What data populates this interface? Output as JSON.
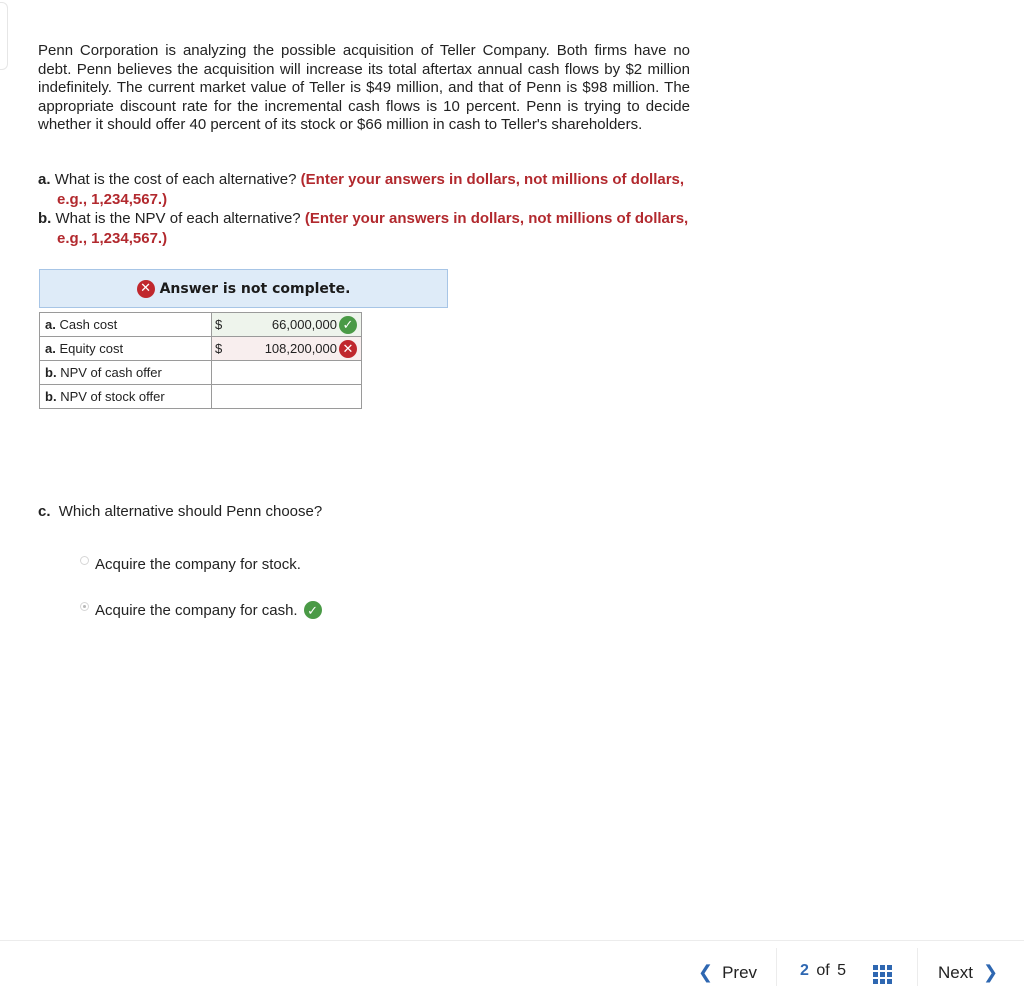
{
  "problem_text": "Penn Corporation is analyzing the possible acquisition of Teller Company. Both firms have no debt. Penn believes the acquisition will increase its total aftertax annual cash flows by $2 million indefinitely. The current market value of Teller is $49 million, and that of Penn is $98 million. The appropriate discount rate for the incremental cash flows is 10 percent. Penn is trying to decide whether it should offer 40 percent of its stock or $66 million in cash to Teller's shareholders.",
  "questions": [
    {
      "label": "a.",
      "text": "What is the cost of each alternative?",
      "hint": "(Enter your answers in dollars, not millions of dollars, e.g., 1,234,567.)"
    },
    {
      "label": "b.",
      "text": "What is the NPV of each alternative?",
      "hint": "(Enter your answers in dollars, not millions of dollars, e.g., 1,234,567.)"
    }
  ],
  "banner": {
    "status_icon": "x-circle-icon",
    "text": "Answer is not complete."
  },
  "answer_table": [
    {
      "prefix": "a.",
      "label": "Cash cost",
      "currency": "$",
      "value": "66,000,000",
      "status": "correct"
    },
    {
      "prefix": "a.",
      "label": "Equity cost",
      "currency": "$",
      "value": "108,200,000",
      "status": "incorrect"
    },
    {
      "prefix": "b.",
      "label": "NPV of cash offer",
      "currency": "",
      "value": "",
      "status": ""
    },
    {
      "prefix": "b.",
      "label": "NPV of stock offer",
      "currency": "",
      "value": "",
      "status": ""
    }
  ],
  "part_c": {
    "label": "c.",
    "question": "Which alternative should Penn choose?",
    "options": [
      {
        "text": "Acquire the company for stock.",
        "selected": false,
        "status": ""
      },
      {
        "text": "Acquire the company for cash.",
        "selected": true,
        "status": "correct"
      }
    ]
  },
  "footer": {
    "prev_label": "Prev",
    "next_label": "Next",
    "current_page": "2",
    "of_label": "of",
    "total_pages": "5",
    "grid_icon": "grid-icon"
  },
  "icons": {
    "check": "✓",
    "x": "✕",
    "chev_left": "❮",
    "chev_right": "❯"
  }
}
